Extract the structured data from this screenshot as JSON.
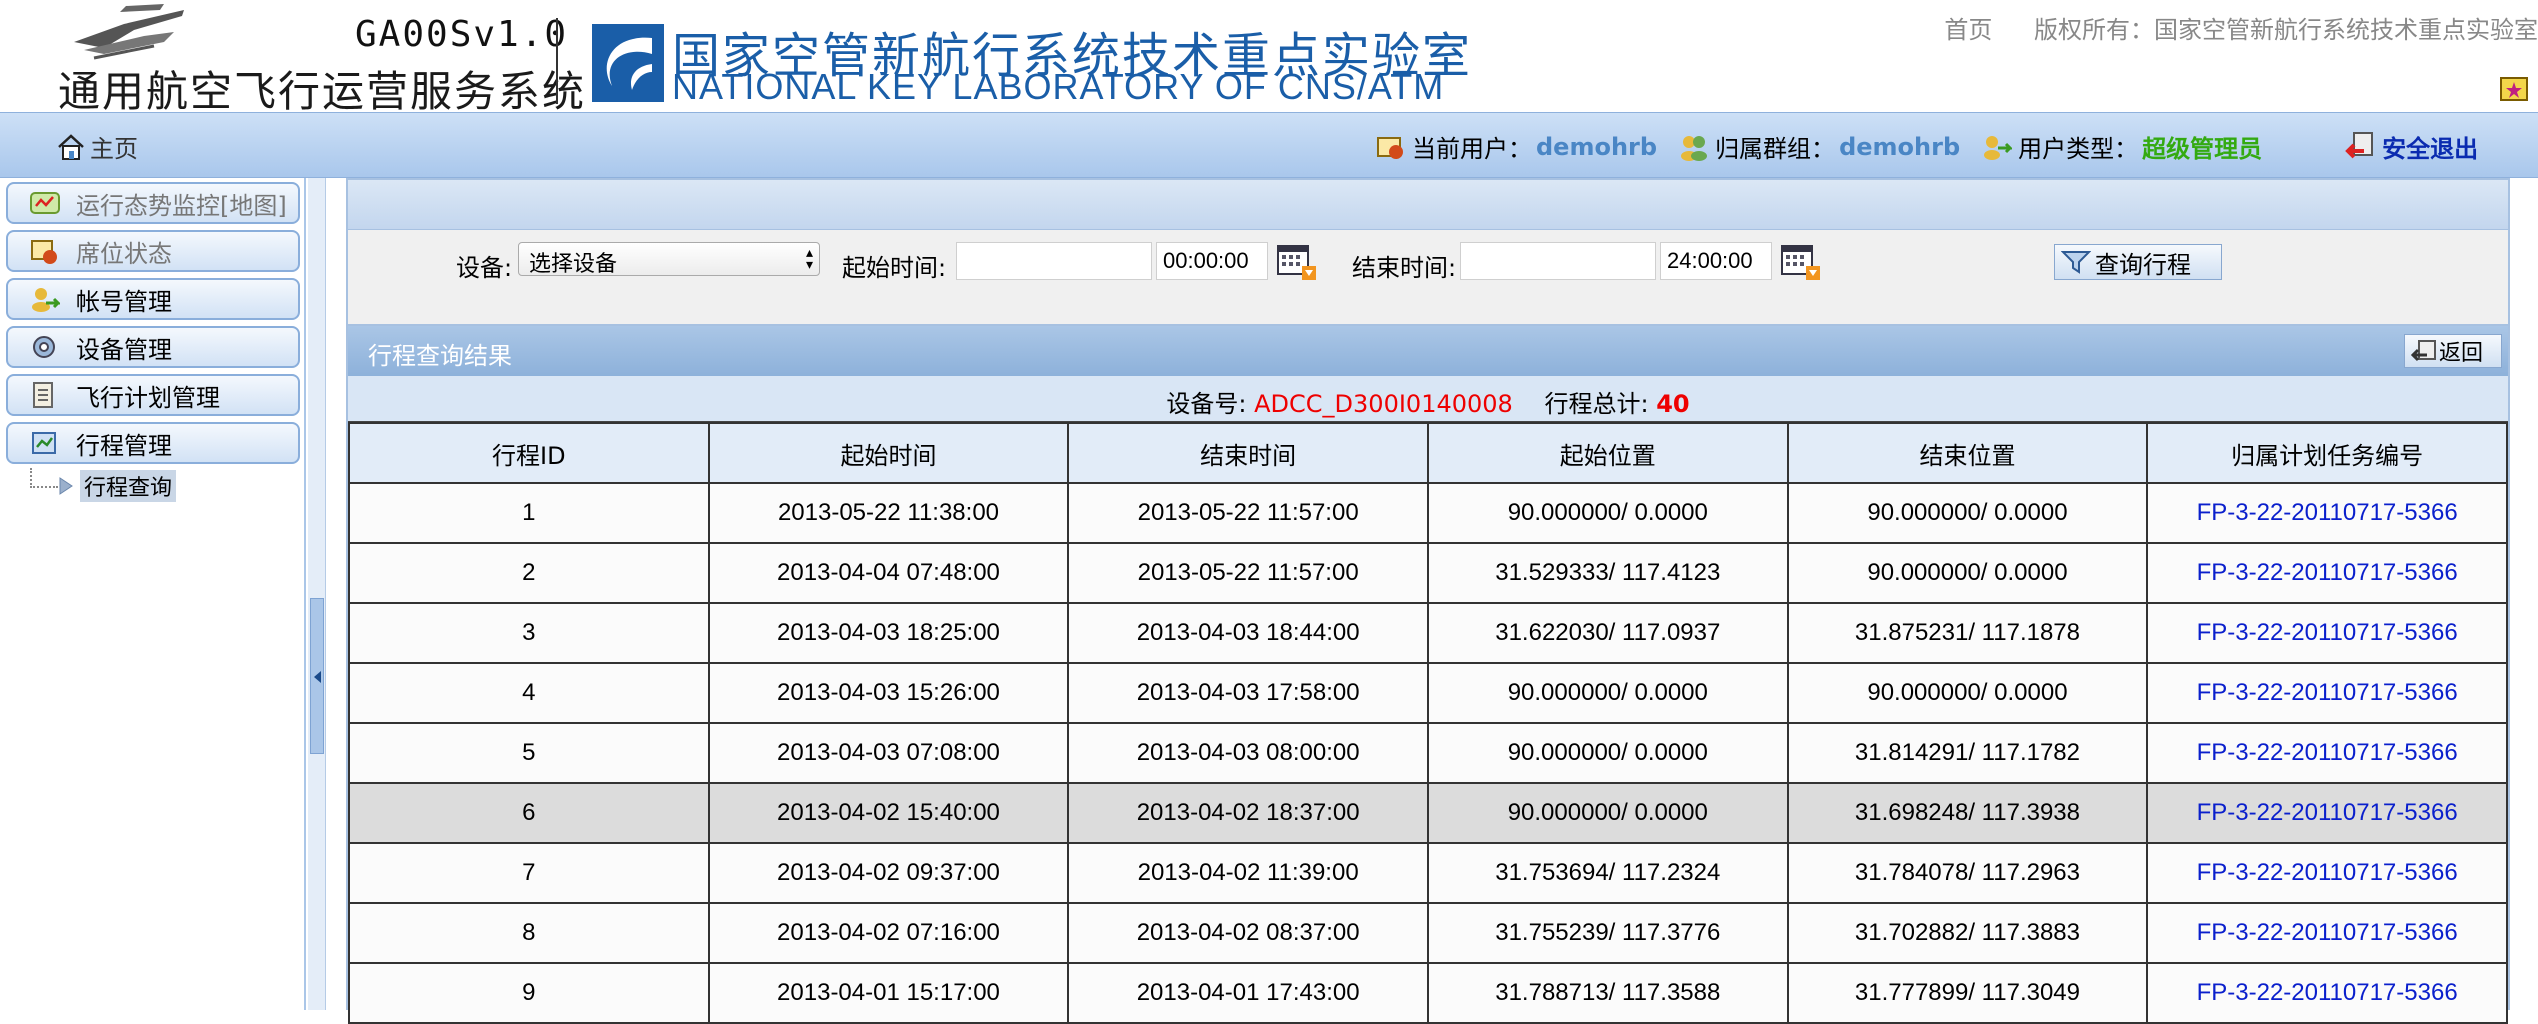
{
  "header": {
    "app_version": "GA00Sv1.0",
    "app_name": "通用航空飞行运营服务系统",
    "lab_name_cn": "国家空管新航行系统技术重点实验室",
    "lab_name_en": "NATIONAL KEY LABORATORY OF CNS/ATM",
    "top_links": [
      "首页",
      "版权所有：国家空管新航行系统技术重点实验室"
    ]
  },
  "navbar": {
    "home_label": "主页",
    "current_user_label": "当前用户：",
    "current_user": "demohrb",
    "group_label": "归属群组：",
    "group": "demohrb",
    "user_type_label": "用户类型：",
    "user_type": "超级管理员",
    "logout_label": "安全退出"
  },
  "sidebar": {
    "items": [
      {
        "label": "运行态势监控[地图]",
        "icon": "monitor-icon"
      },
      {
        "label": "席位状态",
        "icon": "seat-icon"
      },
      {
        "label": "帐号管理",
        "icon": "account-icon"
      },
      {
        "label": "设备管理",
        "icon": "device-icon"
      },
      {
        "label": "飞行计划管理",
        "icon": "plan-icon"
      },
      {
        "label": "行程管理",
        "icon": "trip-icon"
      }
    ],
    "tree_item": "行程查询"
  },
  "search": {
    "device_label": "设备:",
    "device_value": "选择设备",
    "start_label": "起始时间:",
    "start_date": "",
    "start_time": "00:00:00",
    "end_label": "结束时间:",
    "end_date": "",
    "end_time": "24:00:00",
    "query_button": "查询行程"
  },
  "results": {
    "title": "行程查询结果",
    "back_button": "返回",
    "device_no_label": "设备号:",
    "device_no": "ADCC_D300I0140008",
    "total_label": "行程总计:",
    "total": "40",
    "columns": [
      "行程ID",
      "起始时间",
      "结束时间",
      "起始位置",
      "结束位置",
      "归属计划任务编号"
    ],
    "rows": [
      [
        "1",
        "2013-05-22 11:38:00",
        "2013-05-22 11:57:00",
        "90.000000/ 0.0000",
        "90.000000/ 0.0000",
        "FP-3-22-20110717-5366"
      ],
      [
        "2",
        "2013-04-04 07:48:00",
        "2013-05-22 11:57:00",
        "31.529333/ 117.4123",
        "90.000000/ 0.0000",
        "FP-3-22-20110717-5366"
      ],
      [
        "3",
        "2013-04-03 18:25:00",
        "2013-04-03 18:44:00",
        "31.622030/ 117.0937",
        "31.875231/ 117.1878",
        "FP-3-22-20110717-5366"
      ],
      [
        "4",
        "2013-04-03 15:26:00",
        "2013-04-03 17:58:00",
        "90.000000/ 0.0000",
        "90.000000/ 0.0000",
        "FP-3-22-20110717-5366"
      ],
      [
        "5",
        "2013-04-03 07:08:00",
        "2013-04-03 08:00:00",
        "90.000000/ 0.0000",
        "31.814291/ 117.1782",
        "FP-3-22-20110717-5366"
      ],
      [
        "6",
        "2013-04-02 15:40:00",
        "2013-04-02 18:37:00",
        "90.000000/ 0.0000",
        "31.698248/ 117.3938",
        "FP-3-22-20110717-5366"
      ],
      [
        "7",
        "2013-04-02 09:37:00",
        "2013-04-02 11:39:00",
        "31.753694/ 117.2324",
        "31.784078/ 117.2963",
        "FP-3-22-20110717-5366"
      ],
      [
        "8",
        "2013-04-02 07:16:00",
        "2013-04-02 08:37:00",
        "31.755239/ 117.3776",
        "31.702882/ 117.3883",
        "FP-3-22-20110717-5366"
      ],
      [
        "9",
        "2013-04-01 15:17:00",
        "2013-04-01 17:43:00",
        "31.788713/ 117.3588",
        "31.777899/ 117.3049",
        "FP-3-22-20110717-5366"
      ]
    ],
    "highlighted_row": 5
  },
  "colors": {
    "accent_blue": "#4a86c5",
    "link_blue": "#0a1fcc",
    "red": "#ee0000",
    "green": "#33aa11"
  }
}
